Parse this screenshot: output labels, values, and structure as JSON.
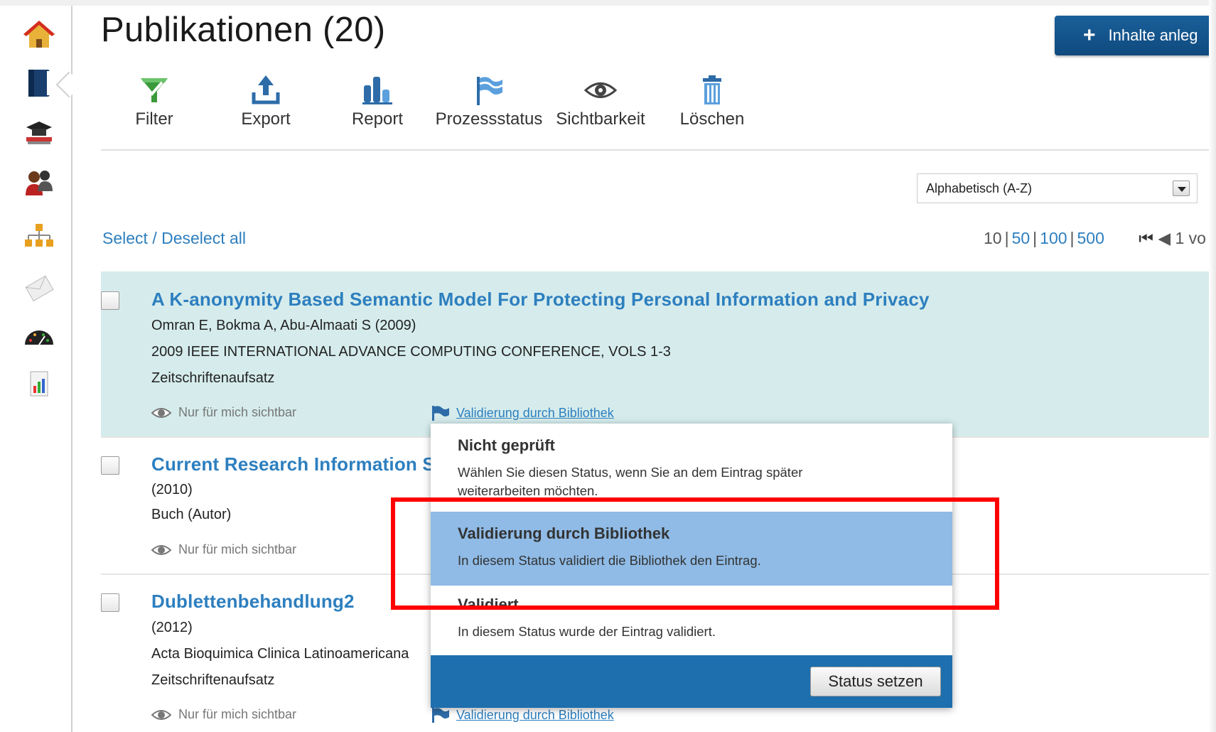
{
  "page": {
    "title": "Publikationen (20)",
    "add_button_label": "Inhalte anleg"
  },
  "sidebar": {
    "items": [
      {
        "icon": "home-icon"
      },
      {
        "icon": "book-icon"
      },
      {
        "icon": "graduation-cap-icon"
      },
      {
        "icon": "users-icon"
      },
      {
        "icon": "org-chart-icon"
      },
      {
        "icon": "envelope-icon"
      },
      {
        "icon": "dashboard-gauge-icon"
      },
      {
        "icon": "report-chart-icon"
      }
    ]
  },
  "toolbar": {
    "items": [
      {
        "label": "Filter",
        "icon": "filter-icon",
        "color": "#3a9a3a"
      },
      {
        "label": "Export",
        "icon": "export-icon",
        "color": "#2d6ca8"
      },
      {
        "label": "Report",
        "icon": "report-icon",
        "color": "#2d6ca8"
      },
      {
        "label": "Prozessstatus",
        "icon": "flag-icon",
        "color": "#2d6ca8"
      },
      {
        "label": "Sichtbarkeit",
        "icon": "eye-icon",
        "color": "#444444"
      },
      {
        "label": "Löschen",
        "icon": "trash-icon",
        "color": "#2d6ca8"
      }
    ]
  },
  "sort": {
    "selected": "Alphabetisch (A-Z)"
  },
  "list_controls": {
    "select_all": "Select / Deselect all",
    "page_sizes": [
      "10",
      "50",
      "100",
      "500"
    ],
    "page_info": "1 vo"
  },
  "publications": [
    {
      "title": "A K-anonymity Based Semantic Model For Protecting Personal Information and Privacy",
      "authors": "Omran E, Bokma A, Abu-Almaati S (2009)",
      "source": "2009 IEEE INTERNATIONAL ADVANCE COMPUTING CONFERENCE, VOLS 1-3",
      "type": "Zeitschriftenaufsatz",
      "visibility": "Nur für mich sichtbar",
      "status": "Validierung durch Bibliothek"
    },
    {
      "title": "Current Research Information Sy",
      "year": "(2010)",
      "type": "Buch (Autor)",
      "visibility": "Nur für mich sichtbar"
    },
    {
      "title": "Dublettenbehandlung2",
      "year": "(2012)",
      "source": "Acta Bioquimica Clinica Latinoamericana",
      "type": "Zeitschriftenaufsatz",
      "visibility": "Nur für mich sichtbar",
      "status": "Validierung durch Bibliothek"
    }
  ],
  "status_popup": {
    "options": [
      {
        "title": "Nicht geprüft",
        "description": "Wählen Sie diesen Status, wenn Sie an dem Eintrag später weiterarbeiten möchten."
      },
      {
        "title": "Validierung durch Bibliothek",
        "description": "In diesem Status validiert die Bibliothek den Eintrag."
      },
      {
        "title": "Validiert",
        "description": "In diesem Status wurde der Eintrag validiert."
      }
    ],
    "submit_label": "Status setzen",
    "selected_color": "#8fbbe6",
    "footer_color": "#1e6fae"
  },
  "annotation": {
    "highlight_color": "#ff0000"
  }
}
